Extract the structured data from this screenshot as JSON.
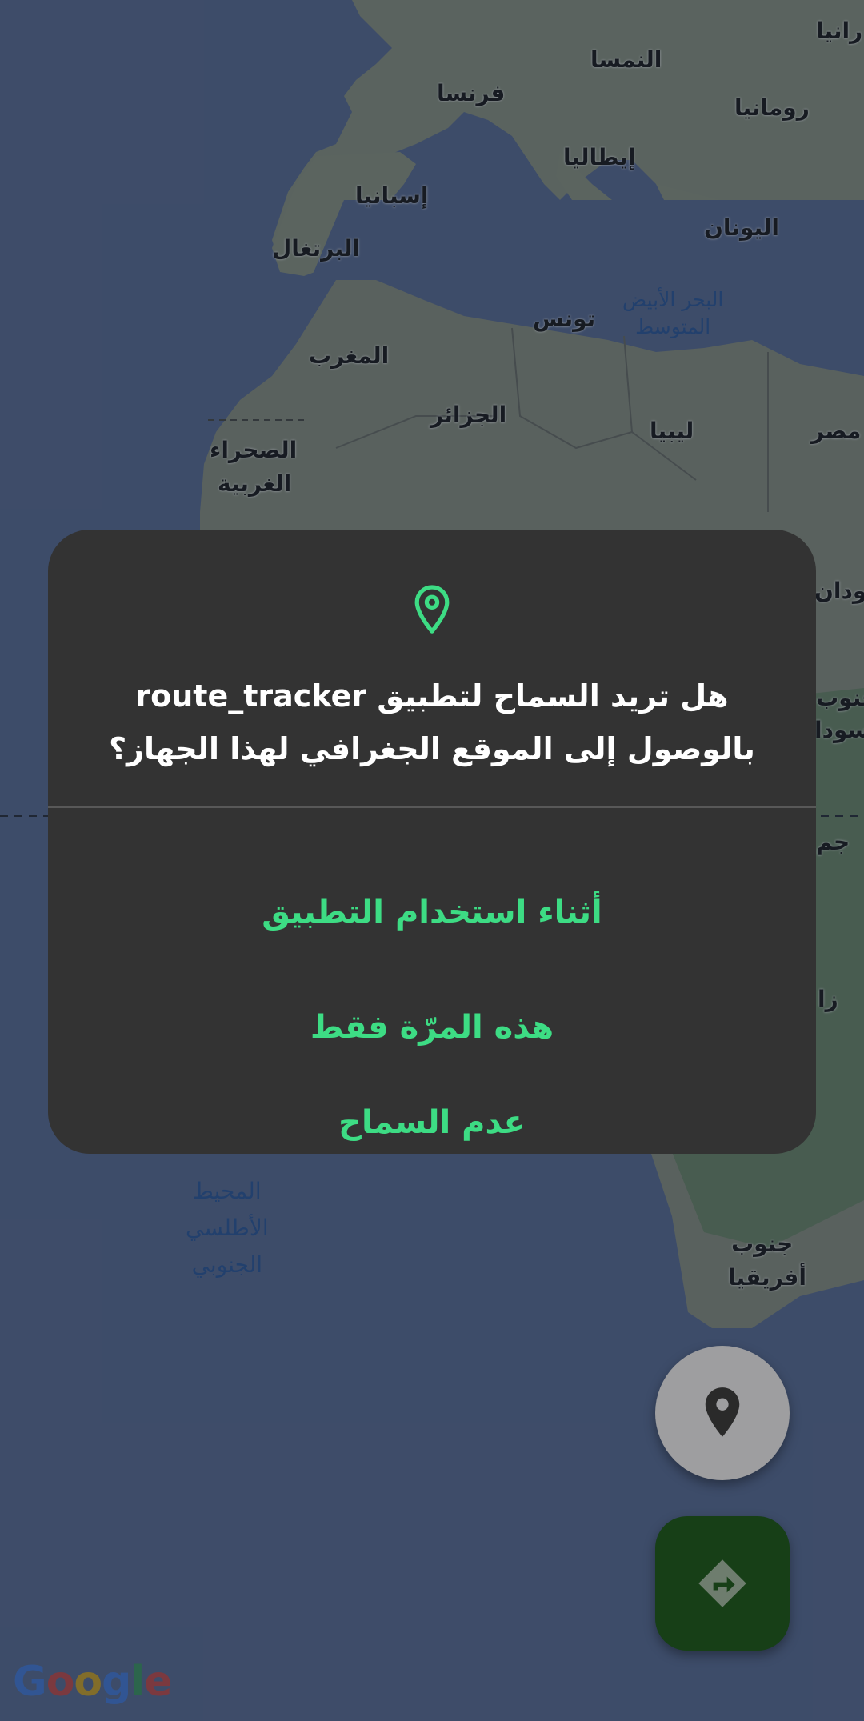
{
  "map": {
    "labels": {
      "austria": "النمسا",
      "france": "فرنسا",
      "romania": "رومانيا",
      "ukraine_partial": "رانيا",
      "italy": "إيطاليا",
      "spain": "إسبانيا",
      "portugal": "البرتغال",
      "greece": "اليونان",
      "tunisia": "تونس",
      "morocco": "المغرب",
      "algeria": "الجزائر",
      "libya": "ليبيا",
      "egypt": "مصر",
      "western_sahara_1": "الصحراء",
      "western_sahara_2": "الغربية",
      "sudan_partial": "سودان",
      "south_sudan_1": "جنوب",
      "south_sudan_2": "السودا",
      "drc_partial": "جم",
      "zambia_partial": "زا",
      "south_africa_1": "جنوب",
      "south_africa_2": "أفريقيا"
    },
    "sea_labels": {
      "mediterranean_1": "البحر الأبيض",
      "mediterranean_2": "المتوسط",
      "south_atlantic_1": "المحيط",
      "south_atlantic_2": "الأطلسي",
      "south_atlantic_3": "الجنوبي"
    },
    "attribution": {
      "g1": "G",
      "o1": "o",
      "o2": "o",
      "g2": "g",
      "l": "l",
      "e": "e"
    }
  },
  "dialog": {
    "icon": "location-pin-icon",
    "title_line1": "هل تريد السماح لتطبيق route_tracker",
    "title_line2": "بالوصول إلى الموقع الجغرافي لهذا الجهاز؟",
    "options": {
      "while_using": "أثناء استخدام التطبيق",
      "only_this_time": "هذه المرّة فقط",
      "deny": "عدم السماح"
    }
  },
  "fabs": {
    "location_icon": "location-pin-icon",
    "directions_icon": "directions-icon"
  },
  "colors": {
    "accent": "#3ddc84",
    "dialog_bg": "#333333",
    "sea": "#3a4a68",
    "fab_primary": "#173f17"
  }
}
